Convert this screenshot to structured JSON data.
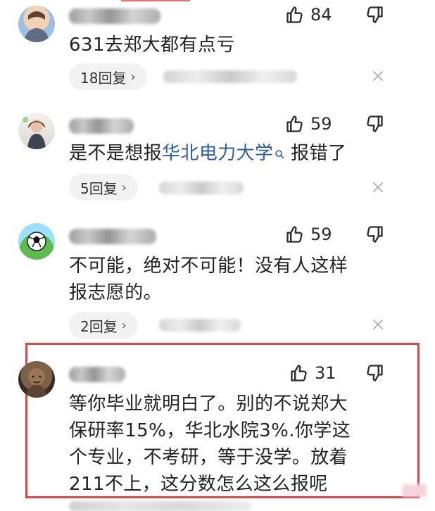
{
  "comments": [
    {
      "likes": "84",
      "text_lines": [
        "631去郑大都有点亏"
      ],
      "reply_label": "18回复",
      "highlighted": false
    },
    {
      "likes": "59",
      "text_prefix": "是不是想报",
      "text_link": "华北电力大学",
      "text_suffix": " 报错了",
      "reply_label": "5回复",
      "highlighted": false
    },
    {
      "likes": "59",
      "text_lines": [
        "不可能，绝对不可能！没有人这样",
        "报志愿的。"
      ],
      "reply_label": "2回复",
      "highlighted": false
    },
    {
      "likes": "31",
      "text_lines": [
        "等你毕业就明白了。别的不说郑大",
        "保研率15%，华北水院3%.你学这",
        "个专业，不考研，等于没学。放着",
        "211不上，这分数怎么这么报呢"
      ],
      "highlighted": true
    }
  ],
  "icons": {
    "like": "thumbs-up-icon",
    "dislike": "thumbs-down-icon",
    "close": "close-icon",
    "search": "search-icon",
    "chevron": "chevron-right-icon"
  },
  "colors": {
    "link": "#2c5ea8",
    "highlight_border": "#e34545",
    "reply_pill_bg": "#f2f2f2"
  }
}
